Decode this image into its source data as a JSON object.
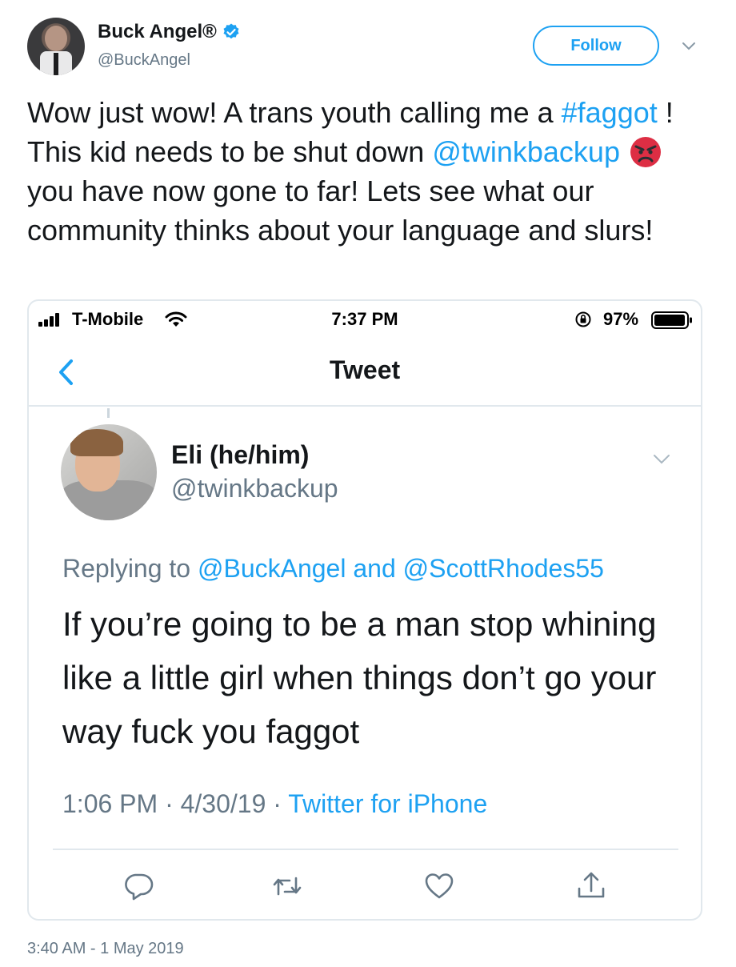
{
  "author": {
    "display_name": "Buck Angel®",
    "handle": "@BuckAngel",
    "verified": true,
    "follow_label": "Follow"
  },
  "tweet": {
    "text_1": "Wow just wow! A trans youth calling me a ",
    "hashtag": "#faggot",
    "text_2": " ! This kid needs to be shut down ",
    "mention": "@twinkbackup",
    "emoji": "angry-face",
    "text_3": "you have now gone to far! Lets see what our community thinks about your language and slurs!",
    "timestamp": "3:40 AM - 1 May 2019"
  },
  "embedded_screenshot": {
    "status_bar": {
      "carrier": "T-Mobile",
      "time": "7:37 PM",
      "battery": "97%"
    },
    "nav_title": "Tweet",
    "reply": {
      "display_name": "Eli (he/him)",
      "handle": "@twinkbackup",
      "replying_prefix": "Replying to ",
      "replying_to_1": "@BuckAngel",
      "replying_and": " and ",
      "replying_to_2": "@ScottRhodes55",
      "text": "If you’re going to be a man stop whining like a little girl when things don’t go your way fuck you faggot",
      "time": "1:06 PM",
      "date": "4/30/19",
      "client": "Twitter for iPhone",
      "separator": " · "
    }
  },
  "colors": {
    "accent": "#1da1f2",
    "text": "#14171a",
    "secondary": "#657786",
    "border": "#e1e8ed"
  }
}
